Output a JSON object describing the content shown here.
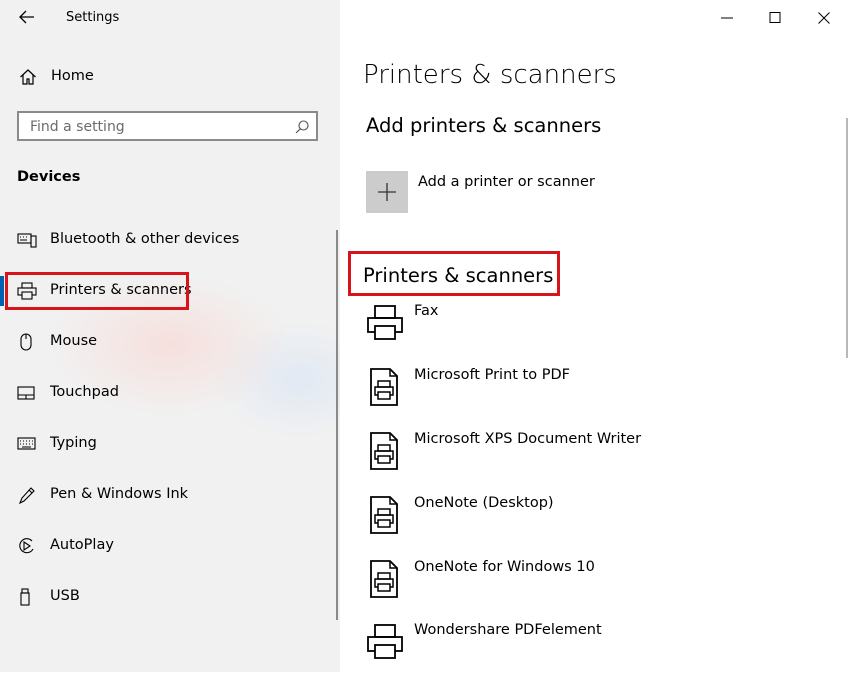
{
  "window": {
    "title": "Settings",
    "controls": [
      "minimize",
      "maximize",
      "close"
    ]
  },
  "sidebar": {
    "home_label": "Home",
    "search_placeholder": "Find a setting",
    "section_title": "Devices",
    "selected_item": "Printers & scanners",
    "items": [
      {
        "label": "Bluetooth & other devices",
        "icon": "keyboard-bluetooth-icon"
      },
      {
        "label": "Printers & scanners",
        "icon": "printer-icon"
      },
      {
        "label": "Mouse",
        "icon": "mouse-icon"
      },
      {
        "label": "Touchpad",
        "icon": "touchpad-icon"
      },
      {
        "label": "Typing",
        "icon": "keyboard-icon"
      },
      {
        "label": "Pen & Windows Ink",
        "icon": "pen-icon"
      },
      {
        "label": "AutoPlay",
        "icon": "autoplay-icon"
      },
      {
        "label": "USB",
        "icon": "usb-icon"
      }
    ]
  },
  "main": {
    "page_title": "Printers & scanners",
    "add_section_title": "Add printers & scanners",
    "add_button_label": "Add a printer or scanner",
    "list_title": "Printers & scanners",
    "printers": [
      {
        "name": "Fax",
        "icon": "fax-printer-icon"
      },
      {
        "name": "Microsoft Print to PDF",
        "icon": "document-printer-icon"
      },
      {
        "name": "Microsoft XPS Document Writer",
        "icon": "document-printer-icon"
      },
      {
        "name": "OneNote (Desktop)",
        "icon": "document-printer-icon"
      },
      {
        "name": "OneNote for Windows 10",
        "icon": "document-printer-icon"
      },
      {
        "name": "Wondershare PDFelement",
        "icon": "printer-icon"
      }
    ]
  },
  "colors": {
    "accent": "#0063b1",
    "highlight": "#d7141a",
    "sidebar_bg": "#f1f1f1"
  }
}
